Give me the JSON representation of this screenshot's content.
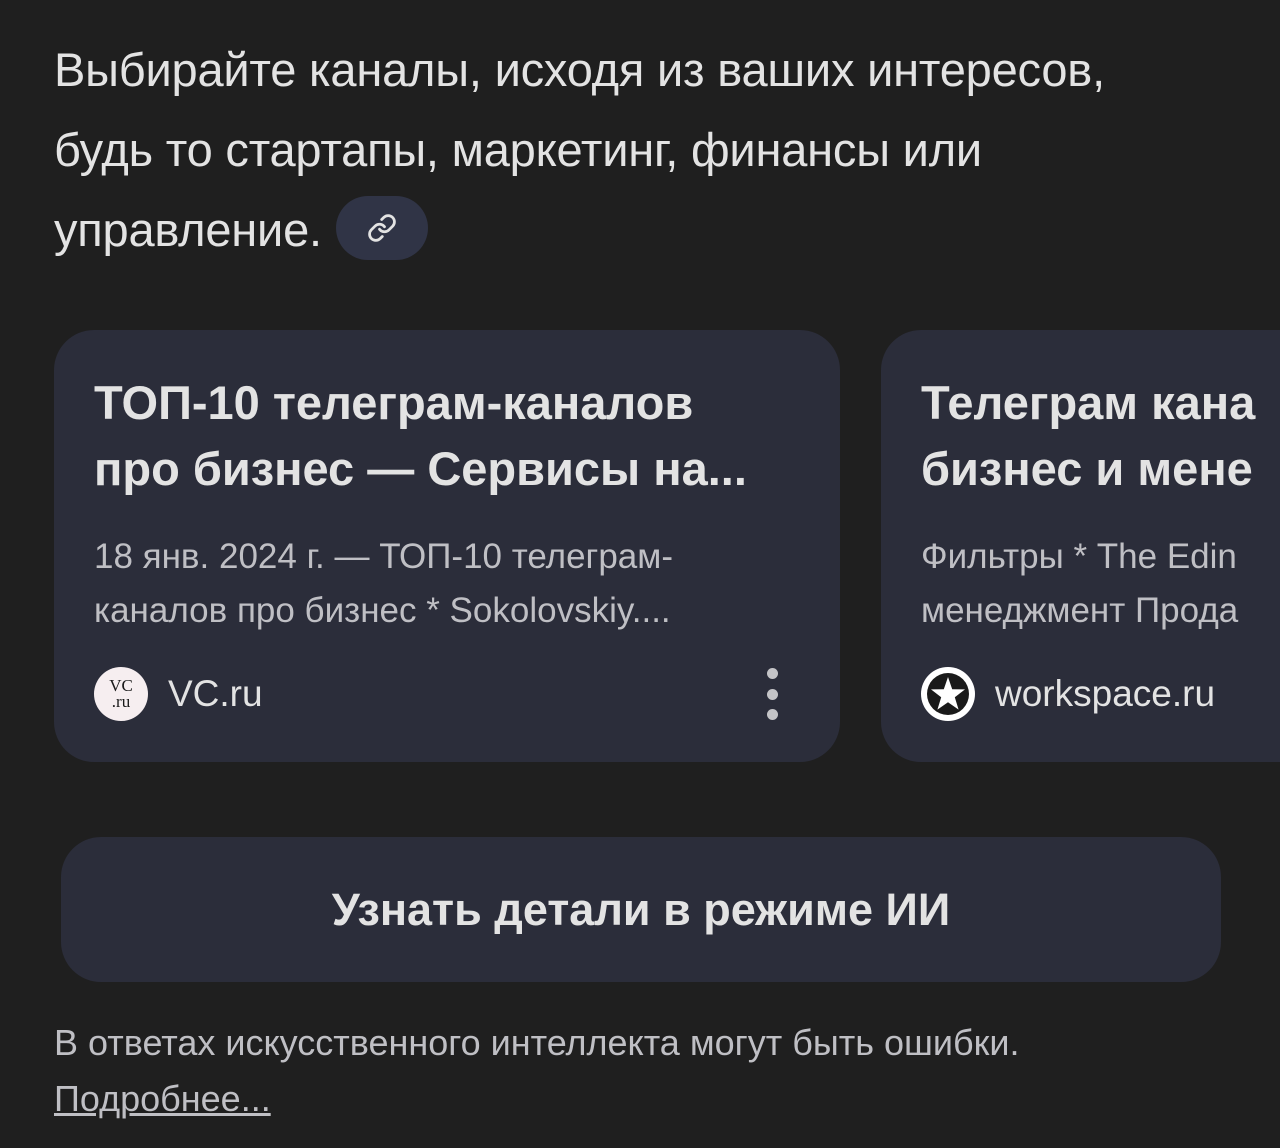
{
  "intro": {
    "text": "Выбирайте каналы, исходя из ваших интересов, будь то стартапы, маркетинг, финансы или управление."
  },
  "cards": [
    {
      "title": "ТОП-10 телеграм-каналов\nпро бизнес — Сервисы на...",
      "snippet": "18 янв. 2024 г. — ТОП-10 телеграм-\nканалов про бизнес * Sokolovskiy....",
      "source": "VC.ru",
      "favicon_top": "VC",
      "favicon_bottom": ".ru"
    },
    {
      "title": "Телеграм кана\nбизнес и мене",
      "snippet": "Фильтры * The Edin\nменеджмент Прода",
      "source": "workspace.ru",
      "favicon_icon": "star-icon"
    }
  ],
  "ai_button": {
    "label": "Узнать детали в режиме ИИ"
  },
  "disclaimer": {
    "text": "В ответах искусственного интеллекта могут быть ошибки.",
    "link": "Подробнее..."
  },
  "colors": {
    "background": "#1f1f1f",
    "card": "#2b2d3a",
    "chip": "#303446",
    "text": "#e3e3e3",
    "muted": "#bfbfc4"
  }
}
